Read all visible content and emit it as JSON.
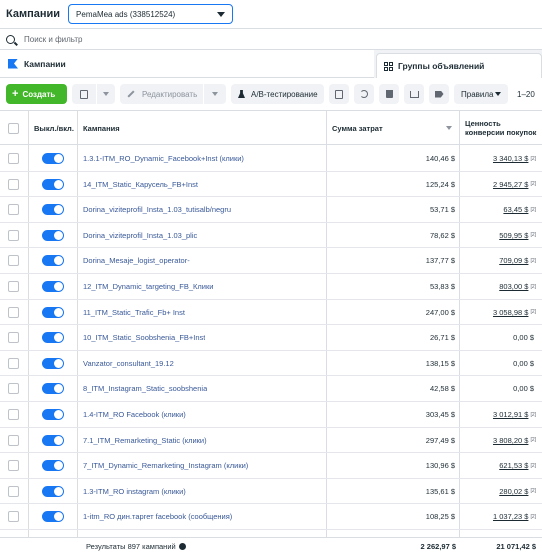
{
  "header": {
    "title": "Кампании",
    "account": "PemaMea ads (338512524)"
  },
  "search": {
    "placeholder": "Поиск и фильтр"
  },
  "tabs": {
    "campaigns": "Кампании",
    "adsets": "Группы объявлений"
  },
  "toolbar": {
    "create": "Создать",
    "edit": "Редактировать",
    "ab_test": "A/B-тестирование",
    "rules": "Правила",
    "pager": "1–20"
  },
  "columns": {
    "toggle": "Выкл./вкл.",
    "campaign": "Кампания",
    "spend": "Сумма затрат",
    "value": "Ценность конверсии покупок"
  },
  "rows": [
    {
      "name": "1.3.1-ITM_RO_Dynamic_Facebook+Inst (клики)",
      "spend": "140,46 $",
      "value": "3 340,13 $",
      "sup": "[2]"
    },
    {
      "name": "14_ITM_Static_Карусель_FB+Inst",
      "spend": "125,24 $",
      "value": "2 945,27 $",
      "sup": "[2]"
    },
    {
      "name": "Dorina_viziteprofil_Insta_1.03_tutisalb/negru",
      "spend": "53,71 $",
      "value": "63,45 $",
      "sup": "[2]"
    },
    {
      "name": "Dorina_viziteprofil_Insta_1.03_plic",
      "spend": "78,62 $",
      "value": "509,95 $",
      "sup": "[2]"
    },
    {
      "name": "Dorina_Mesaje_logist_operator-",
      "spend": "137,77 $",
      "value": "709,09 $",
      "sup": "[2]"
    },
    {
      "name": "12_ITM_Dynamic_targeting_FB_Клики",
      "spend": "53,83 $",
      "value": "803,00 $",
      "sup": "[2]"
    },
    {
      "name": "11_ITM_Static_Trafic_Fb+ Inst",
      "spend": "247,00 $",
      "value": "3 058,98 $",
      "sup": "[2]"
    },
    {
      "name": "10_ITM_Static_Soobshenia_FB+Inst",
      "spend": "26,71 $",
      "value": "0,00 $",
      "sup": ""
    },
    {
      "name": "Vanzator_consultant_19.12",
      "spend": "138,15 $",
      "value": "0,00 $",
      "sup": ""
    },
    {
      "name": "8_ITM_Instagram_Static_soobshenia",
      "spend": "42,58 $",
      "value": "0,00 $",
      "sup": ""
    },
    {
      "name": "1.4-ITM_RO Facebook (клики)",
      "spend": "303,45 $",
      "value": "3 012,91 $",
      "sup": "[2]"
    },
    {
      "name": "7.1_ITM_Remarketing_Static (клики)",
      "spend": "297,49 $",
      "value": "3 808,20 $",
      "sup": "[2]"
    },
    {
      "name": "7_ITM_Dynamic_Remarketing_Instagram (клики)",
      "spend": "130,96 $",
      "value": "621,53 $",
      "sup": "[2]"
    },
    {
      "name": "1.3-ITM_RO instagram (клики)",
      "spend": "135,61 $",
      "value": "280,02 $",
      "sup": "[2]"
    },
    {
      "name": "1-itm_RO дин.таргет facebook (сообщения)",
      "spend": "108,25 $",
      "value": "1 037,23 $",
      "sup": "[2]"
    }
  ],
  "footer": {
    "results": "Результаты 897 кампаний",
    "total_spend": "2 262,97 $",
    "total_value": "21 071,42 $"
  },
  "colors": {
    "accent": "#1877f2",
    "create": "#42b72a",
    "link": "#385898"
  }
}
